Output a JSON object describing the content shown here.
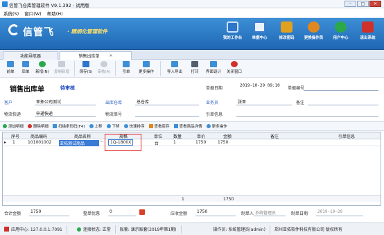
{
  "window": {
    "title": "信管飞仓库管理软件 V9.1.392 - 试用版",
    "btn_min": "–",
    "btn_max": "□",
    "btn_close": "✕"
  },
  "menu": [
    "系统(S)",
    "窗口(W)",
    "帮助(H)"
  ],
  "brand": {
    "name": "信管飞",
    "tagline": "· 精细化管理软件"
  },
  "topnav": [
    {
      "label": "我的工作台",
      "color": "#2e76c9"
    },
    {
      "label": "单据中心",
      "color": "#3f7fd0"
    },
    {
      "label": "修改密码",
      "color": "#e0a020"
    },
    {
      "label": "更换操作员",
      "color": "#e08820"
    },
    {
      "label": "用户中心",
      "color": "#2aa84a"
    },
    {
      "label": "退出系统",
      "color": "#d0302a"
    }
  ],
  "tabs": [
    {
      "label": "功能导航器"
    },
    {
      "label": "销售出库单",
      "close": "×"
    }
  ],
  "toolbar": [
    {
      "label": "前单",
      "color": "#3f8fd6",
      "disabled": false
    },
    {
      "label": "后单",
      "color": "#3f8fd6",
      "disabled": false
    },
    {
      "label": "新增(N)",
      "color": "#2aa84a",
      "disabled": false
    },
    {
      "label": "复制新增",
      "color": "#9aa3ad",
      "disabled": true
    },
    {
      "label": "保存(S)",
      "color": "#2e76c9",
      "disabled": false
    },
    {
      "label": "审核(A)",
      "color": "#9aa3ad",
      "disabled": true
    },
    {
      "label": "引单",
      "color": "#3f8fd6",
      "disabled": false
    },
    {
      "label": "更多操作",
      "color": "#3f8fd6",
      "disabled": false
    },
    {
      "label": "导入导出",
      "color": "#3f8fd6",
      "disabled": false
    },
    {
      "label": "打印",
      "color": "#555f6b",
      "disabled": false
    },
    {
      "label": "界面设计",
      "color": "#3f8fd6",
      "disabled": false
    },
    {
      "label": "关闭窗口",
      "color": "#d0302a",
      "disabled": false
    }
  ],
  "header": {
    "title": "销售出库单",
    "status": "待审核",
    "date_label": "单据日期",
    "date_value": "2019-10-29 09:10",
    "no_label": "单据编号",
    "customer_label": "客户",
    "customer_value": "亚拓公司测试",
    "warehouse_label": "出库仓库",
    "warehouse_value": "总仓库",
    "salesman_label": "业务员",
    "salesman_value": "张亚",
    "remark_label": "备注",
    "express_label": "物流快递",
    "express_value": "申通快递",
    "tracking_label": "物流单号",
    "ref_label": "引单信息"
  },
  "gridtools": [
    {
      "label": "添加明细",
      "color": "#2aa84a"
    },
    {
      "label": "删除明细",
      "color": "#d0302a"
    },
    {
      "label": "扫描条形码(F4)",
      "color": "#3f8fd6"
    },
    {
      "label": "上移",
      "color": "#3f8fd6"
    },
    {
      "label": "下移",
      "color": "#3f8fd6"
    },
    {
      "label": "快速排序",
      "color": "#3f8fd6"
    },
    {
      "label": "查看库存",
      "color": "#e08820"
    },
    {
      "label": "查看商品详情",
      "color": "#3f8fd6"
    },
    {
      "label": "更多操作",
      "color": "#3f8fd6"
    }
  ],
  "grid": {
    "columns": [
      "序号",
      "商品编码",
      "商品名称",
      "规格",
      "单位",
      "数量",
      "单价",
      "金额",
      "备注",
      "引单信息"
    ],
    "rows": [
      {
        "marker": "▸",
        "index": "1",
        "code": "101001002",
        "name": "亚拓测试商品",
        "spec": "1Q-1800X",
        "unit": "台",
        "qty": "1",
        "price": "1750",
        "amount": "1750",
        "remark": "",
        "ref": ""
      }
    ],
    "footer": {
      "qty": "1",
      "amount": "1750"
    }
  },
  "summary": {
    "total_label": "合计金额",
    "total_value": "1750",
    "discount_label": "整单优惠",
    "discount_value": "0",
    "receivable_label": "应收金额",
    "receivable_value": "1750",
    "maker_label": "制单人",
    "maker_value": "系统管理员",
    "make_date_label": "制单日期",
    "make_date_value": "2019-10-29"
  },
  "statusbar": {
    "app_center": "应用中心: 127.0.0.1:7091",
    "conn": "连接状态: 正常",
    "books": "账套: 演示账套(2019年第1期)",
    "operator": "操作员: 系统管理员(admin)",
    "company": "郑州亚拓软件科技有限公司 版权所有"
  }
}
